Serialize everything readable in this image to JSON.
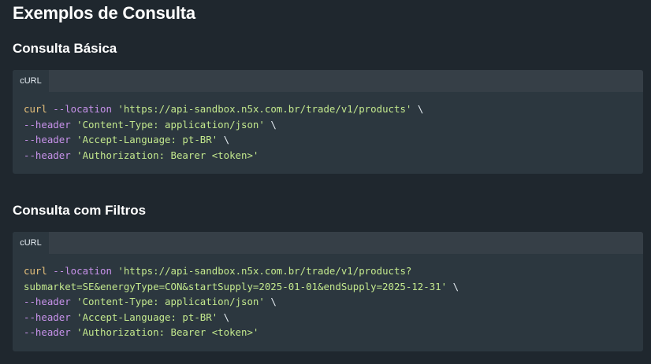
{
  "page": {
    "title": "Exemplos de Consulta"
  },
  "sections": [
    {
      "title": "Consulta Básica",
      "tab_label": "cURL",
      "lines": [
        [
          {
            "cls": "tk-cmd",
            "t": "curl"
          },
          {
            "cls": "tk-flag",
            "t": " --location "
          },
          {
            "cls": "tk-str",
            "t": "'https://api-sandbox.n5x.com.br/trade/v1/products'"
          },
          {
            "cls": "tk-plain",
            "t": " \\"
          }
        ],
        [
          {
            "cls": "tk-flag",
            "t": "--header "
          },
          {
            "cls": "tk-str",
            "t": "'Content-Type: application/json'"
          },
          {
            "cls": "tk-plain",
            "t": " \\"
          }
        ],
        [
          {
            "cls": "tk-flag",
            "t": "--header "
          },
          {
            "cls": "tk-str",
            "t": "'Accept-Language: pt-BR'"
          },
          {
            "cls": "tk-plain",
            "t": " \\"
          }
        ],
        [
          {
            "cls": "tk-flag",
            "t": "--header "
          },
          {
            "cls": "tk-str",
            "t": "'Authorization: Bearer <token>'"
          }
        ]
      ]
    },
    {
      "title": "Consulta com Filtros",
      "tab_label": "cURL",
      "lines": [
        [
          {
            "cls": "tk-cmd",
            "t": "curl"
          },
          {
            "cls": "tk-flag",
            "t": " --location "
          },
          {
            "cls": "tk-str",
            "t": "'https://api-sandbox.n5x.com.br/trade/v1/products?"
          }
        ],
        [
          {
            "cls": "tk-str",
            "t": "submarket=SE&energyType=CON&startSupply=2025-01-01&endSupply=2025-12-31'"
          },
          {
            "cls": "tk-plain",
            "t": " \\"
          }
        ],
        [
          {
            "cls": "tk-flag",
            "t": "--header "
          },
          {
            "cls": "tk-str",
            "t": "'Content-Type: application/json'"
          },
          {
            "cls": "tk-plain",
            "t": " \\"
          }
        ],
        [
          {
            "cls": "tk-flag",
            "t": "--header "
          },
          {
            "cls": "tk-str",
            "t": "'Accept-Language: pt-BR'"
          },
          {
            "cls": "tk-plain",
            "t": " \\"
          }
        ],
        [
          {
            "cls": "tk-flag",
            "t": "--header "
          },
          {
            "cls": "tk-str",
            "t": "'Authorization: Bearer <token>'"
          }
        ]
      ]
    }
  ]
}
